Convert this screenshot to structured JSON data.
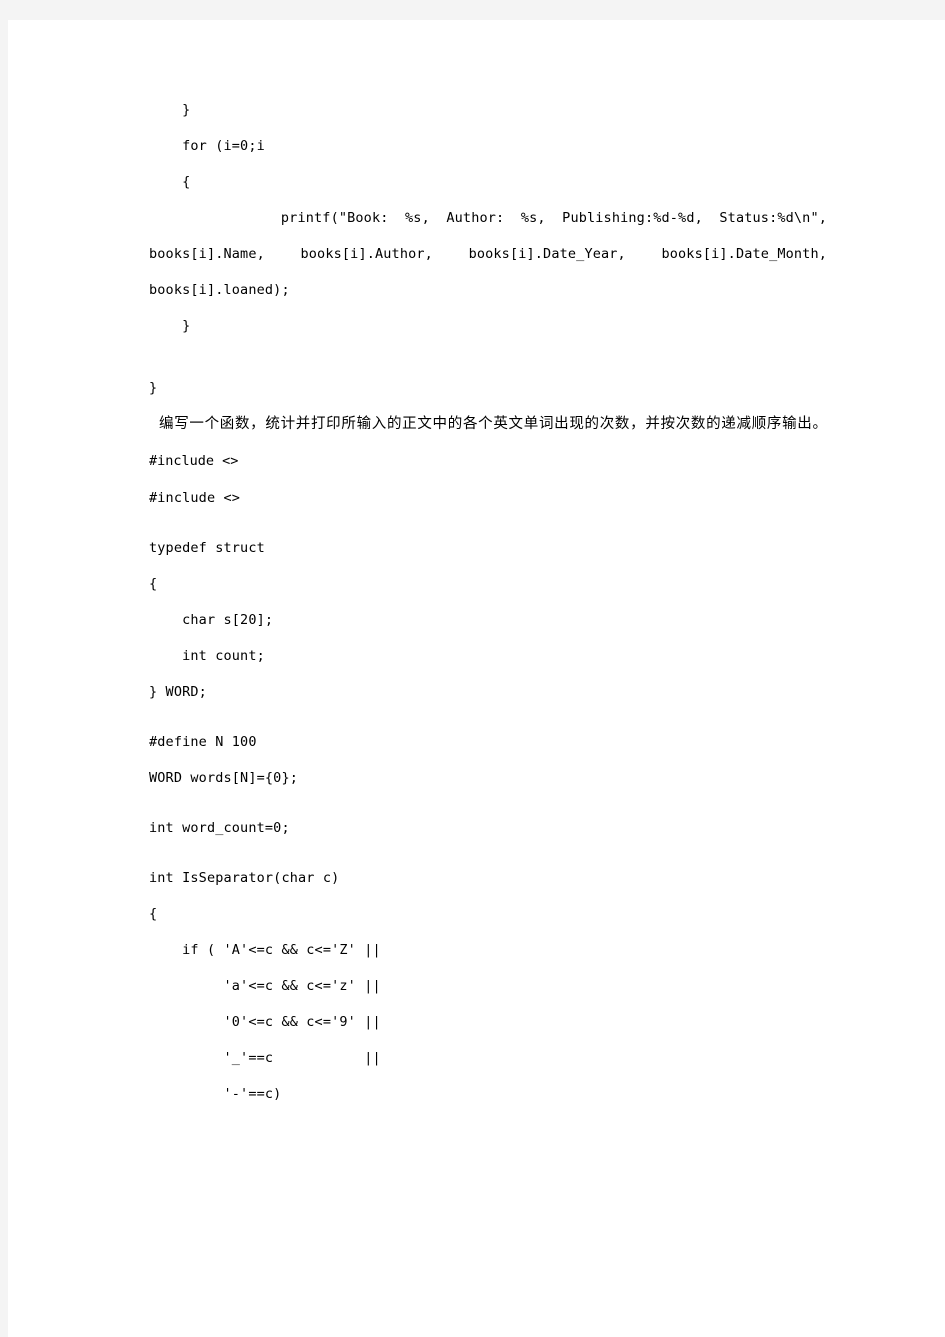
{
  "document": {
    "page_background": "#ffffff",
    "canvas_background": "#f4f4f4",
    "text_color": "#000000"
  },
  "code_block_1": {
    "lines": [
      "    }",
      "",
      "    for (i=0;i",
      "    {"
    ]
  },
  "printf_statement": {
    "line1": "        printf(\"Book:  %s,   Author:  %s,   Publishing:%d-%d,   Status:%d\\n\",",
    "line1_segments": [
      "printf(\"Book:",
      "%s,",
      "Author:",
      "%s,",
      "Publishing:%d-%d,",
      "Status:%d\\n\","
    ],
    "line2_segments": [
      "books[i].Name,",
      "books[i].Author,",
      "books[i].Date_Year,",
      "books[i].Date_Month,"
    ],
    "line3": "books[i].loaned);",
    "closing_brace": "    }"
  },
  "closing_brace_outer": "}",
  "prompt_text": {
    "paragraph": "编写一个函数，统计并打印所输入的正文中的各个英文单词出现的次数，并按次数的递减顺序输出。",
    "trailing_code": "#include <>"
  },
  "code_block_2": {
    "include_line": "#include <>",
    "typedef_lines": [
      "typedef struct",
      "{",
      "    char s[20];",
      "    int count;",
      "} WORD;"
    ],
    "define_lines": [
      "#define N 100",
      "WORD words[N]={0};"
    ],
    "word_count_line": "int word_count=0;",
    "function_signature": "int IsSeparator(char c)",
    "function_open_brace": "{",
    "condition_lines": [
      "    if ( 'A'<=c && c<='Z' ||",
      "         'a'<=c && c<='z' ||",
      "         '0'<=c && c<='9' ||",
      "         '_'==c           ||",
      "         '-'==c)"
    ]
  }
}
